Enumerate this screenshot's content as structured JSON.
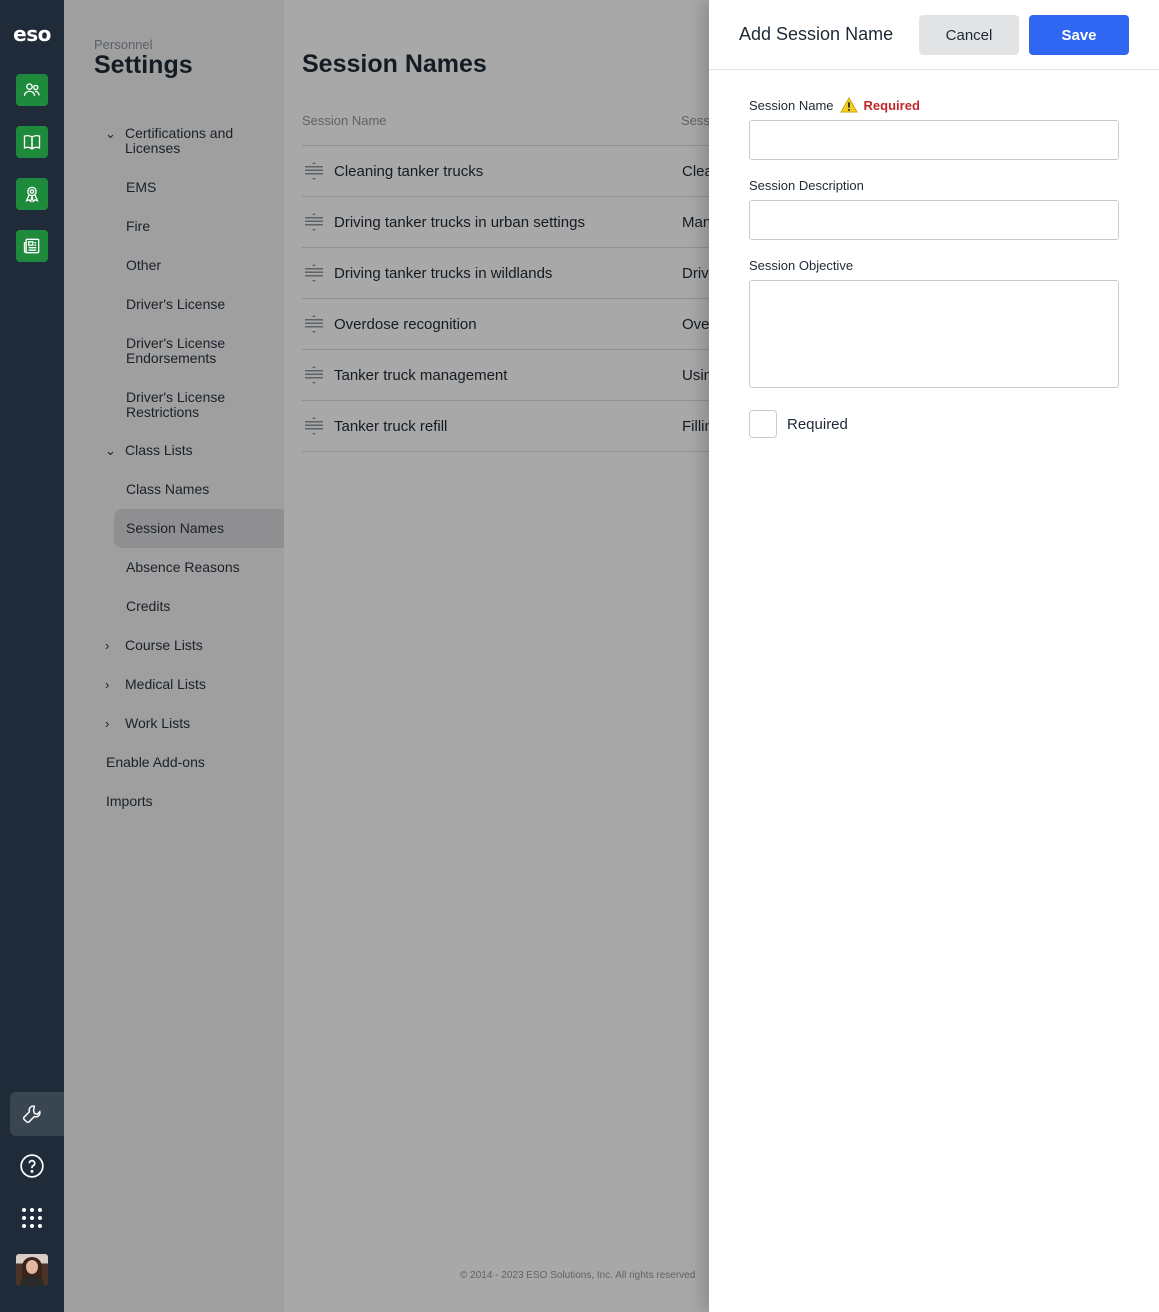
{
  "rail": {
    "logo": "eso",
    "apps": [
      "people-icon",
      "book-icon",
      "award-icon",
      "newspaper-icon"
    ],
    "bottom": [
      "wrench-icon",
      "help-icon",
      "grid-icon",
      "avatar"
    ]
  },
  "subnav": {
    "eyebrow": "Personnel",
    "title": "Settings",
    "items": [
      {
        "label": "Certifications and Licenses",
        "expanded": true
      },
      {
        "label": "EMS"
      },
      {
        "label": "Fire"
      },
      {
        "label": "Other"
      },
      {
        "label": "Driver's License"
      },
      {
        "label": "Driver's License Endorsements"
      },
      {
        "label": "Driver's License Restrictions"
      },
      {
        "label": "Class Lists",
        "expanded": true
      },
      {
        "label": "Class Names"
      },
      {
        "label": "Session Names",
        "active": true
      },
      {
        "label": "Absence Reasons"
      },
      {
        "label": "Credits"
      },
      {
        "label": "Course Lists",
        "expanded": false
      },
      {
        "label": "Medical Lists",
        "expanded": false
      },
      {
        "label": "Work Lists",
        "expanded": false
      },
      {
        "label": "Enable Add-ons"
      },
      {
        "label": "Imports"
      }
    ]
  },
  "main": {
    "title": "Session Names",
    "columns": [
      "Session Name",
      "Sess"
    ],
    "rows": [
      {
        "name": "Cleaning tanker trucks",
        "desc": "Clea"
      },
      {
        "name": "Driving tanker trucks in urban settings",
        "desc": "Man"
      },
      {
        "name": "Driving tanker trucks in wildlands",
        "desc": "Driv"
      },
      {
        "name": "Overdose recognition",
        "desc": "Ove"
      },
      {
        "name": "Tanker truck management",
        "desc": "Usin"
      },
      {
        "name": "Tanker truck refill",
        "desc": "Fillin"
      }
    ],
    "copyright": "© 2014 - 2023 ESO Solutions, Inc. All rights reserved"
  },
  "drawer": {
    "title": "Add Session Name",
    "cancel_label": "Cancel",
    "save_label": "Save",
    "fields": {
      "session_name_label": "Session Name",
      "session_name_required": "Required",
      "session_name_value": "",
      "session_description_label": "Session Description",
      "session_description_value": "",
      "session_objective_label": "Session Objective",
      "session_objective_value": ""
    },
    "required_checkbox_label": "Required",
    "required_checked": false
  },
  "colors": {
    "rail": "#1f2b38",
    "rail_app": "#1d8a3c",
    "primary": "#2f66f2",
    "required": "#c0272d"
  }
}
